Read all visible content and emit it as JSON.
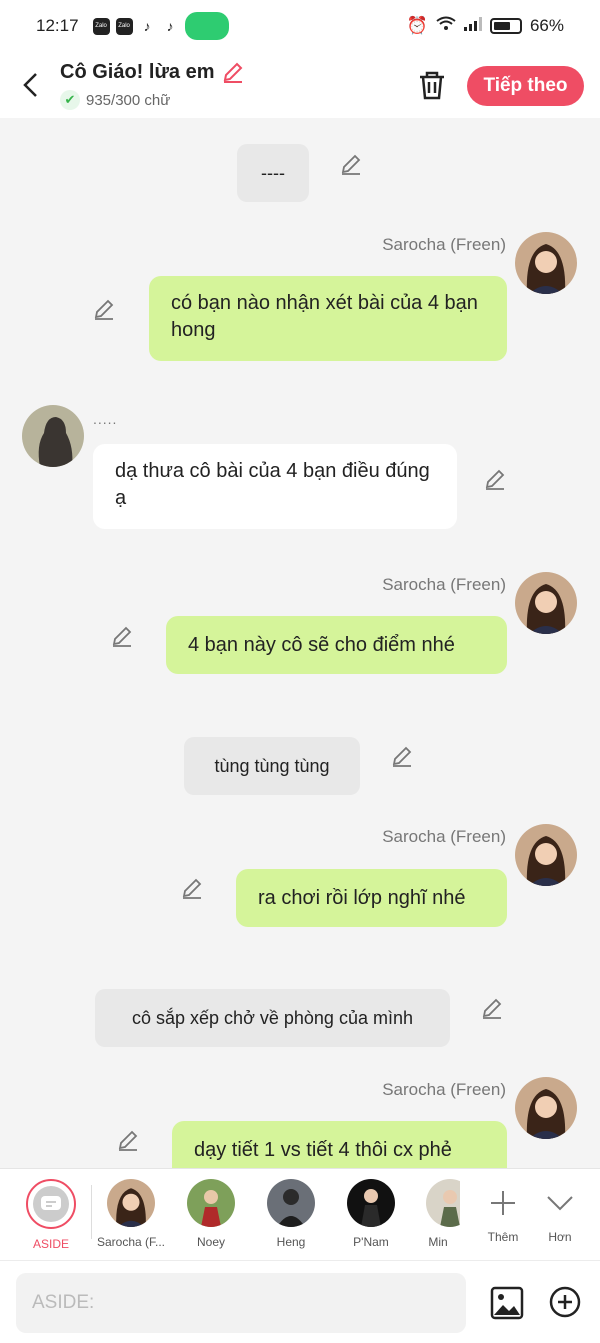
{
  "status": {
    "time": "12:17",
    "battery": "66%",
    "battery_level": 0.66
  },
  "header": {
    "title": "Cô Giáo! lừa em",
    "word_count": "935/300 chữ",
    "next_label": "Tiếp theo"
  },
  "messages": {
    "narr1": "----",
    "name1": "Sarocha (Freen)",
    "m1": "có bạn nào nhận xét bài của 4 bạn hong",
    "name2": ".....",
    "m2": "dạ thưa cô bài của 4 bạn điều đúng ạ",
    "name3": "Sarocha (Freen)",
    "m3": "4 bạn này cô sẽ cho điểm nhé",
    "narr2": "tùng tùng tùng",
    "name4": "Sarocha (Freen)",
    "m4": "ra chơi rồi lớp nghĩ nhé",
    "narr3": "cô sắp xếp chở về phòng của mình",
    "name5": "Sarocha (Freen)",
    "m5": "dạy tiết 1 vs tiết 4 thôi cx phẻ"
  },
  "cast": {
    "aside": "ASIDE",
    "c1": "Sarocha (F...",
    "c2": "Noey",
    "c3": "Heng",
    "c4": "P'Nam",
    "c5": "Min",
    "more": "Thêm",
    "collapse": "Hơn"
  },
  "input": {
    "placeholder": "ASIDE:"
  }
}
